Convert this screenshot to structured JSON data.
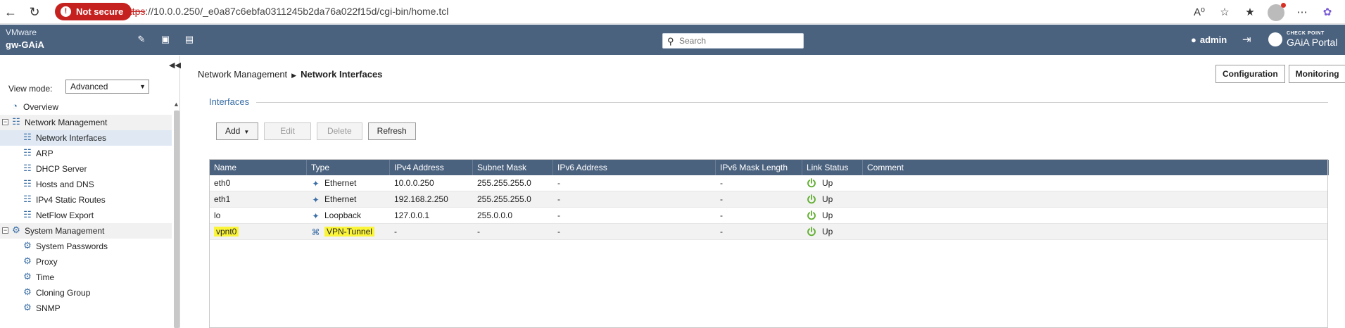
{
  "browser": {
    "security_label": "Not secure",
    "url_scheme": "https",
    "url_rest": "://10.0.0.250/_e0a87c6ebfa0311245b2da76a022f15d/cgi-bin/home.tcl"
  },
  "header": {
    "brand": "VMware",
    "hostname": "gw-GAiA",
    "search_placeholder": "Search",
    "user": "admin",
    "logo_top": "CHECK POINT",
    "logo_bottom": "GAiA Portal"
  },
  "sidebar": {
    "view_mode_label": "View mode:",
    "view_mode_value": "Advanced",
    "items": [
      {
        "label": "Overview",
        "icon": "dashboard-icon",
        "level": 0
      },
      {
        "label": "Network Management",
        "icon": "network-icon",
        "level": 0,
        "group": true
      },
      {
        "label": "Network Interfaces",
        "icon": "network-icon",
        "level": 1,
        "selected": true
      },
      {
        "label": "ARP",
        "icon": "network-icon",
        "level": 1
      },
      {
        "label": "DHCP Server",
        "icon": "network-icon",
        "level": 1
      },
      {
        "label": "Hosts and DNS",
        "icon": "network-icon",
        "level": 1
      },
      {
        "label": "IPv4 Static Routes",
        "icon": "network-icon",
        "level": 1
      },
      {
        "label": "NetFlow Export",
        "icon": "network-icon",
        "level": 1
      },
      {
        "label": "System Management",
        "icon": "gear-icon",
        "level": 0,
        "group": true
      },
      {
        "label": "System Passwords",
        "icon": "gear-icon",
        "level": 1
      },
      {
        "label": "Proxy",
        "icon": "gear-icon",
        "level": 1
      },
      {
        "label": "Time",
        "icon": "gear-icon",
        "level": 1
      },
      {
        "label": "Cloning Group",
        "icon": "gear-icon",
        "level": 1
      },
      {
        "label": "SNMP",
        "icon": "gear-icon",
        "level": 1
      }
    ]
  },
  "main": {
    "breadcrumb_parent": "Network Management",
    "breadcrumb_current": "Network Interfaces",
    "configuration_label": "Configuration",
    "monitoring_label": "Monitoring",
    "section_title": "Interfaces",
    "actions": {
      "add": "Add",
      "edit": "Edit",
      "delete": "Delete",
      "refresh": "Refresh"
    }
  },
  "table": {
    "columns": [
      "Name",
      "Type",
      "IPv4 Address",
      "Subnet Mask",
      "IPv6 Address",
      "IPv6 Mask Length",
      "Link Status",
      "Comment"
    ],
    "rows": [
      {
        "name": "eth0",
        "type": "Ethernet",
        "ipv4": "10.0.0.250",
        "mask": "255.255.255.0",
        "ipv6": "-",
        "ipv6mask": "-",
        "status": "Up",
        "comment": "",
        "highlight": false
      },
      {
        "name": "eth1",
        "type": "Ethernet",
        "ipv4": "192.168.2.250",
        "mask": "255.255.255.0",
        "ipv6": "-",
        "ipv6mask": "-",
        "status": "Up",
        "comment": "",
        "highlight": false
      },
      {
        "name": "lo",
        "type": "Loopback",
        "ipv4": "127.0.0.1",
        "mask": "255.0.0.0",
        "ipv6": "-",
        "ipv6mask": "-",
        "status": "Up",
        "comment": "",
        "highlight": false
      },
      {
        "name": "vpnt0",
        "type": "VPN-Tunnel",
        "ipv4": "-",
        "mask": "-",
        "ipv6": "-",
        "ipv6mask": "-",
        "status": "Up",
        "comment": "",
        "highlight": true
      }
    ]
  },
  "colors": {
    "header_bg": "#4b627f",
    "link_status_up": "#5fae2e",
    "highlight": "#fbf53a",
    "not_secure": "#c5221f"
  }
}
